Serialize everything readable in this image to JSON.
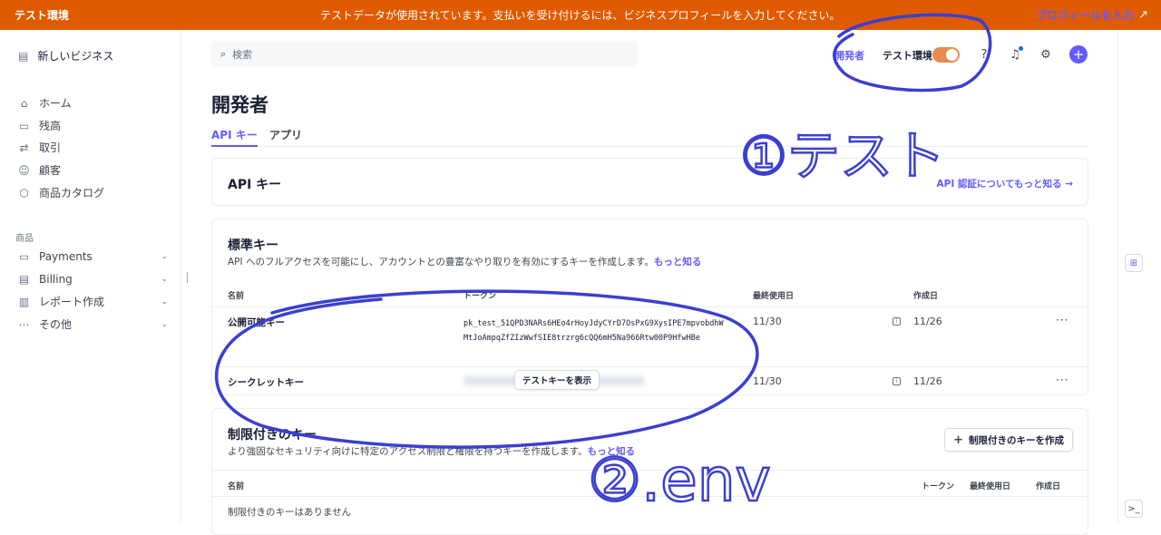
{
  "banner": {
    "env_label": "テスト環境",
    "message": "テストデータが使用されています。支払いを受け付けるには、ビジネスプロフィールを入力してください。",
    "profile_link": "プロフィールを入力",
    "arrow": "↗"
  },
  "sidebar": {
    "business": "新しいビジネス",
    "items": [
      {
        "label": "ホーム",
        "icon": "home-icon"
      },
      {
        "label": "残高",
        "icon": "balance-icon"
      },
      {
        "label": "取引",
        "icon": "transactions-icon"
      },
      {
        "label": "顧客",
        "icon": "customers-icon"
      },
      {
        "label": "商品カタログ",
        "icon": "product-catalog-icon"
      }
    ],
    "section_label": "商品",
    "product_items": [
      {
        "label": "Payments",
        "icon": "payments-icon"
      },
      {
        "label": "Billing",
        "icon": "billing-icon"
      },
      {
        "label": "レポート作成",
        "icon": "reports-icon"
      },
      {
        "label": "その他",
        "icon": "more-icon"
      }
    ]
  },
  "topbar": {
    "search_placeholder": "検索",
    "developers_link": "開発者",
    "test_mode_label": "テスト環境",
    "test_mode_on": true
  },
  "page": {
    "title": "開発者",
    "tabs": [
      {
        "label": "API キー",
        "active": true
      },
      {
        "label": "アプリ",
        "active": false
      }
    ]
  },
  "api_keys_card": {
    "title": "API キー",
    "learn_link": "API 認証についてもっと知る →"
  },
  "standard_keys": {
    "title": "標準キー",
    "description": "API へのフルアクセスを可能にし、アカウントとの豊富なやり取りを有効にするキーを作成します。",
    "learn_more": "もっと知る",
    "columns": [
      "名前",
      "トークン",
      "最終使用日",
      "作成日"
    ],
    "rows": [
      {
        "name": "公開可能キー",
        "token": "pk_test_51QPD3NARs6HEo4rHoyJdyCYrD7OsPxG9XysIPE7mpvobdhWMtJoAmpqZfZIzWwfSIE8trzrg6cQQ6mH5Na966Rtw00P9HfwHBe",
        "last_used": "11/30",
        "created": "11/26"
      },
      {
        "name": "シークレットキー",
        "reveal_button": "テストキーを表示",
        "last_used": "11/30",
        "created": "11/26"
      }
    ]
  },
  "restricted_keys": {
    "title": "制限付きのキー",
    "description": "より強固なセキュリティ向けに特定のアクセス制限と権限を持つキーを作成します。",
    "learn_more": "もっと知る",
    "create_button": "制限付きのキーを作成",
    "columns": [
      "名前",
      "トークン",
      "最終使用日",
      "作成日"
    ],
    "empty_text": "制限付きのキーはありません"
  },
  "annotations": {
    "note1": "①テスト",
    "note2": "②.env",
    "ink_color": "#3b3fcf"
  }
}
